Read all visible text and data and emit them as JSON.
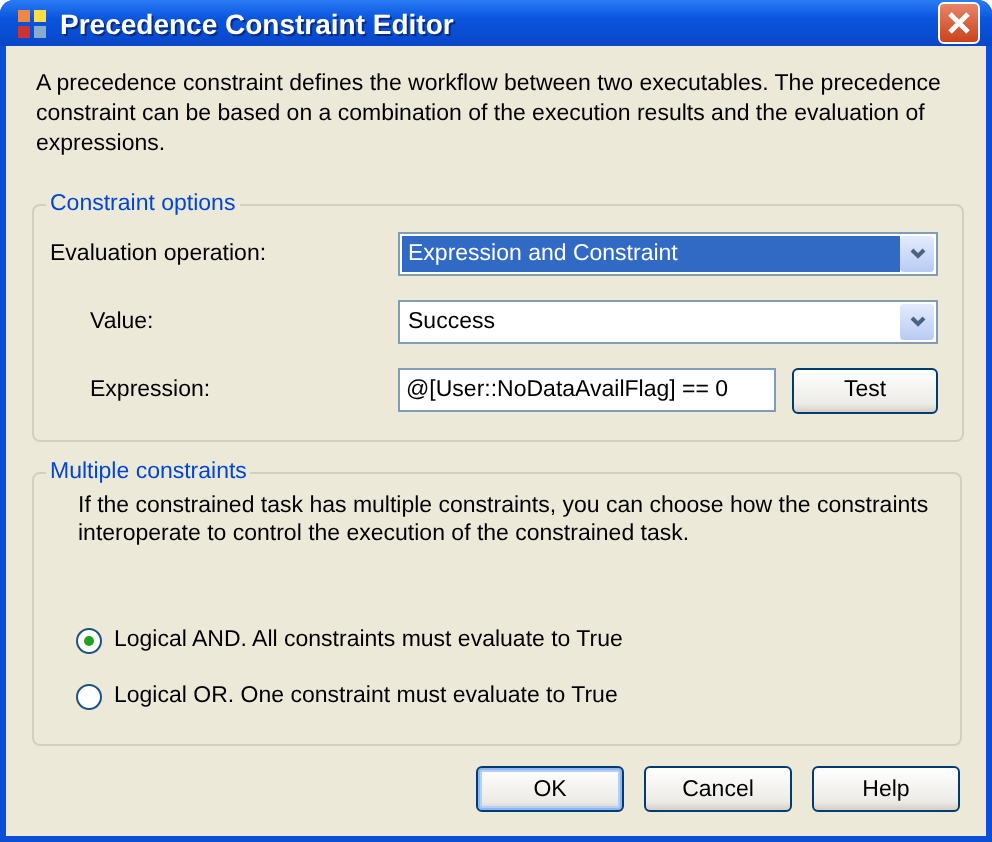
{
  "window": {
    "title": "Precedence Constraint Editor"
  },
  "description": "A precedence constraint defines the workflow between two executables. The precedence constraint can be based on a combination of the execution results and the evaluation of expressions.",
  "constraint_options": {
    "title": "Constraint options",
    "evaluation_operation": {
      "label": "Evaluation operation:",
      "value": "Expression and Constraint",
      "focused": true
    },
    "value": {
      "label": "Value:",
      "value": "Success",
      "focused": false
    },
    "expression": {
      "label": "Expression:",
      "value": "@[User::NoDataAvailFlag] == 0",
      "button": "Test"
    }
  },
  "multiple_constraints": {
    "title": "Multiple constraints",
    "description": "If the constrained task has multiple constraints, you can choose how the constraints interoperate to control the execution of the constrained task.",
    "options": [
      {
        "label": "Logical AND. All constraints must evaluate to True",
        "selected": true
      },
      {
        "label": "Logical OR. One constraint must evaluate to True",
        "selected": false
      }
    ]
  },
  "buttons": [
    {
      "label": "OK",
      "default": true
    },
    {
      "label": "Cancel",
      "default": false
    },
    {
      "label": "Help",
      "default": false
    }
  ]
}
